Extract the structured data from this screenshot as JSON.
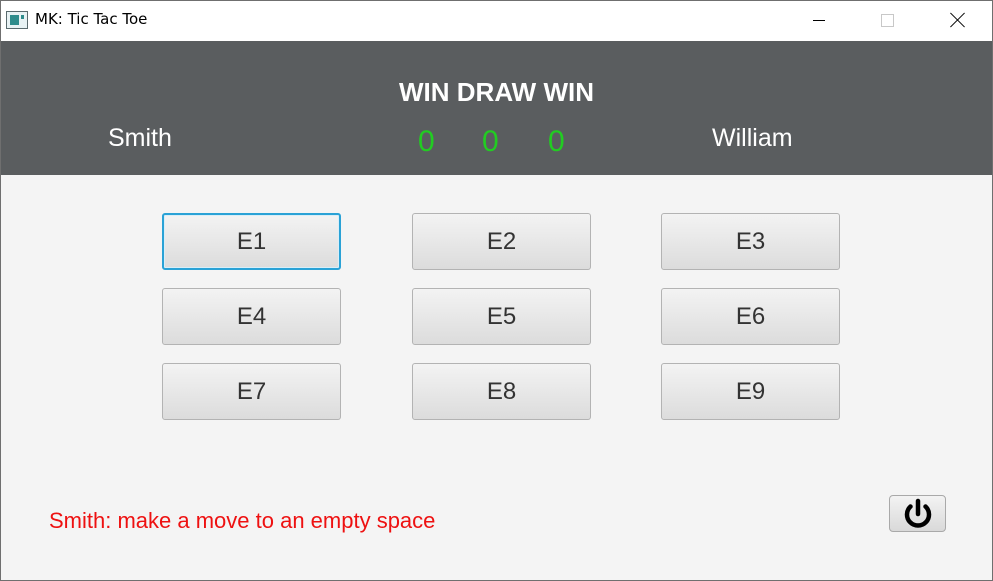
{
  "window": {
    "title": "MK: Tic Tac Toe",
    "icon": "app-window-icon",
    "controls": [
      "minimize-icon",
      "maximize-icon",
      "close-icon"
    ]
  },
  "scoreboard": {
    "title": "WIN DRAW WIN",
    "player1": "Smith",
    "player2": "William",
    "player1_wins": "0",
    "draws": "0",
    "player2_wins": "0",
    "score_color": "#22cc22",
    "header_bg": "#5a5d5f"
  },
  "board": {
    "cells": [
      "E1",
      "E2",
      "E3",
      "E4",
      "E5",
      "E6",
      "E7",
      "E8",
      "E9"
    ],
    "focused_cell": "E1"
  },
  "status": {
    "message": "Smith: make a move to an empty space",
    "color": "#ee1111"
  },
  "power_button": {
    "icon": "power-icon"
  }
}
